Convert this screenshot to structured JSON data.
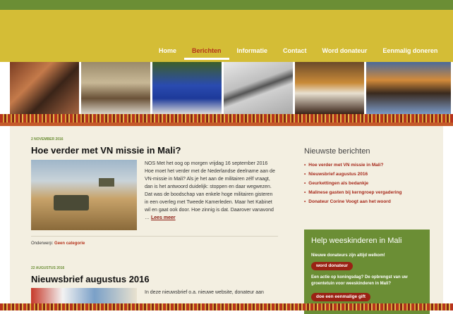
{
  "nav": {
    "items": [
      "Home",
      "Berichten",
      "Informatie",
      "Contact",
      "Word donateur",
      "Eenmalig doneren"
    ],
    "active": "Berichten"
  },
  "banner_photos": [
    "workshop-photo",
    "car-photo",
    "students-blue-photo",
    "bell-tower-photo",
    "children-checkers-photo",
    "classroom-photo"
  ],
  "posts": [
    {
      "date": "2 NOVEMBER 2016",
      "title": "Hoe verder met VN missie in Mali?",
      "excerpt": "NOS Met het oog op morgen vrijdag 16 september 2016 Hoe moet het verder met de Nederlandse deelname aan de VN-missie in Mali? Als je het aan de militairen zélf vraagt, dan is het antwoord duidelijk: stoppen en daar wegwezen. Dat was de boodschap van enkele hoge militairen gisteren in een overleg met Tweede Kamerleden. Maar het Kabinet wil en gaat ook door. Hoe zinnig is dat. Daarover vanavond …",
      "more": "Lees meer",
      "category_label": "Onderwerp:",
      "category": "Geen categorie"
    },
    {
      "date": "22 AUGUSTUS 2016",
      "title": "Nieuwsbrief augustus 2016",
      "excerpt": "In deze nieuwsbrief o.a. nieuwe website, donateur aan"
    }
  ],
  "sidebar": {
    "recent_title": "Nieuwste berichten",
    "recent": [
      "Hoe verder met VN missie in Mali?",
      "Nieuwsbrief augustus 2016",
      "Geurkettingen als bedankje",
      "Malinese gasten bij kerngroep vergadering",
      "Donateur Corine Voogt aan het woord"
    ],
    "widget": {
      "title": "Help weeskinderen in Mali",
      "line1": "Nieuwe donateurs zijn altijd welkom!",
      "btn1": "word donateur",
      "line2": "Een actie op koningsdag? De opbrengst van uw groentetuin voor weeskinderen in Mali?",
      "btn2": "doe een eenmalige gift"
    }
  },
  "colors": {
    "green": "#6b8e35",
    "yellow": "#d4bd36",
    "red": "#b5341c"
  }
}
